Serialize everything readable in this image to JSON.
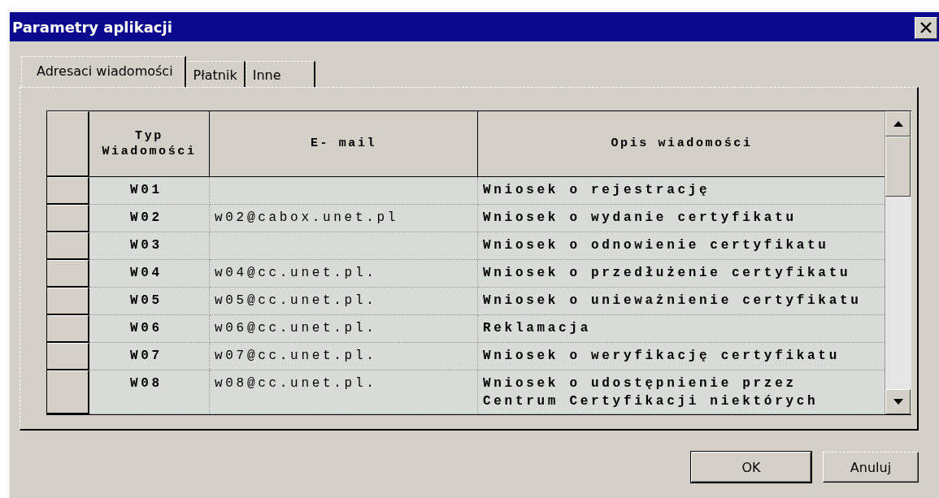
{
  "window": {
    "title": "Parametry aplikacji"
  },
  "tabs": [
    {
      "label": "Adresaci wiadomości",
      "selected": true
    },
    {
      "label": "Płatnik",
      "selected": false
    },
    {
      "label": "Inne",
      "selected": false
    }
  ],
  "table": {
    "columns": [
      "Typ Wiadomości",
      "E- mail",
      "Opis wiadomości"
    ],
    "rows": [
      {
        "type": "W01",
        "description": "Wniosek o rejestrację"
      },
      {
        "type": "W02",
        "email": "w02@cabox.unet.pl",
        "description": "Wniosek o wydanie certyfikatu"
      },
      {
        "type": "W03",
        "description": "Wniosek o odnowienie certyfikatu"
      },
      {
        "type": "W04",
        "email": "w04@cc.unet.pl.",
        "description": "Wniosek o przedłużenie certyfikatu"
      },
      {
        "type": "W05",
        "email": "w05@cc.unet.pl.",
        "description": "Wniosek o unieważnienie certyfikatu"
      },
      {
        "type": "W06",
        "email": "w06@cc.unet.pl.",
        "description": "Reklamacja"
      },
      {
        "type": "W07",
        "email": "w07@cc.unet.pl.",
        "description": "Wniosek o weryfikację certyfikatu"
      },
      {
        "type": "W08",
        "email": "w08@cc.unet.pl.",
        "description": "Wniosek o udostępnienie przez Centrum Certyfikacji niektórych"
      }
    ]
  },
  "buttons": [
    "OK",
    "Anuluj"
  ]
}
